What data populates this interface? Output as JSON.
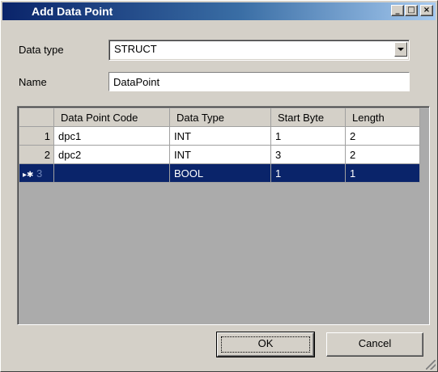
{
  "window": {
    "title": "Add Data Point",
    "buttons": {
      "minimize": "_",
      "maximize": "□",
      "close": "×"
    }
  },
  "form": {
    "data_type_label": "Data type",
    "data_type_value": "STRUCT",
    "name_label": "Name",
    "name_value": "DataPoint"
  },
  "grid": {
    "columns": [
      "Data Point Code",
      "Data Type",
      "Start Byte",
      "Length"
    ],
    "rows": [
      {
        "index": "1",
        "cells": [
          "dpc1",
          "INT",
          "1",
          "2"
        ]
      },
      {
        "index": "2",
        "cells": [
          "dpc2",
          "INT",
          "3",
          "2"
        ]
      },
      {
        "index": "3",
        "marker": "▸✱",
        "cells": [
          "",
          "BOOL",
          "1",
          "1"
        ]
      }
    ],
    "selected_row": 3
  },
  "footer": {
    "ok_label": "OK",
    "cancel_label": "Cancel"
  },
  "colors": {
    "title_gradient_start": "#0a246a",
    "selection": "#0a246a",
    "face": "#d4d0c8",
    "grid_background": "#ababab"
  }
}
